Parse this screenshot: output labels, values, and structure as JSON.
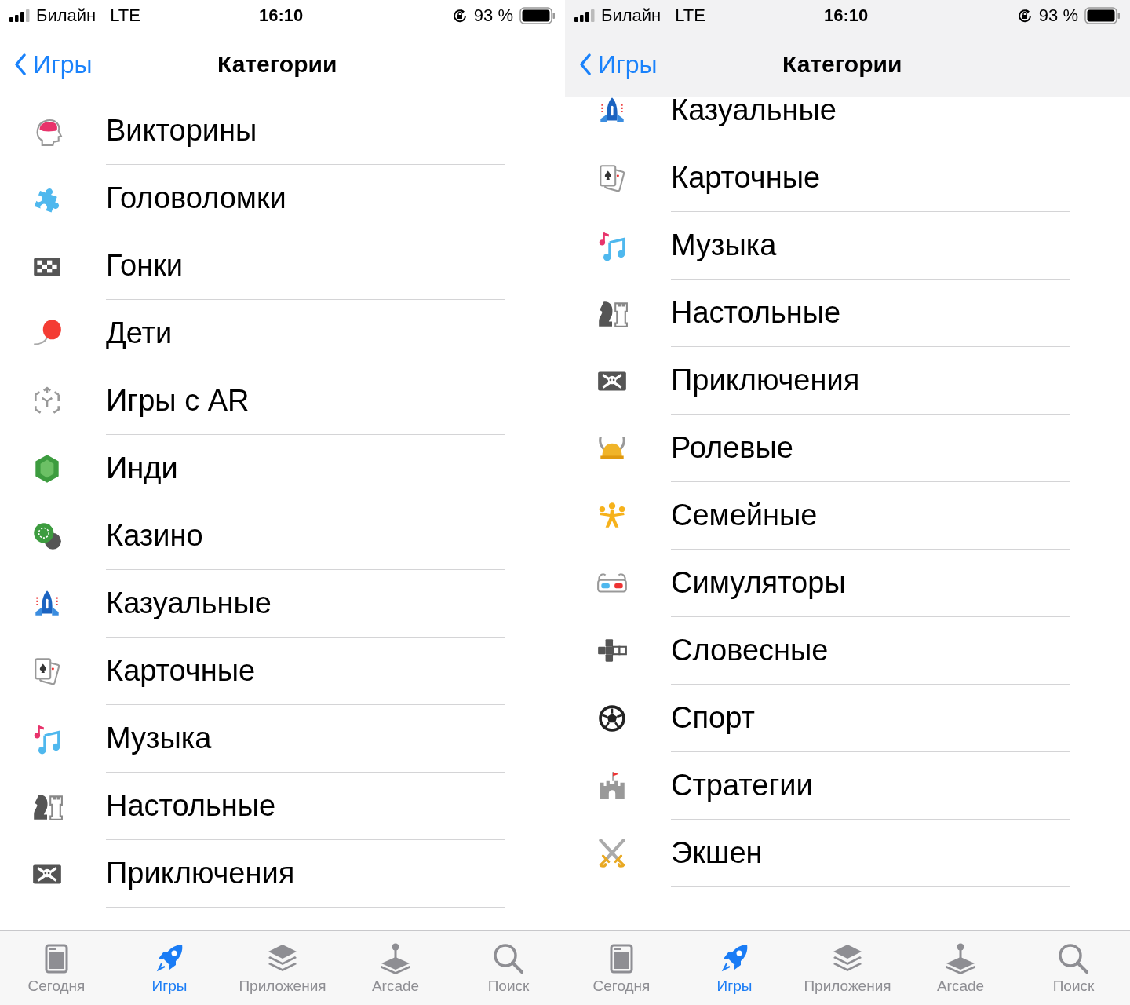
{
  "screens": [
    {
      "status_bar": {
        "carrier": "Билайн",
        "network": "LTE",
        "time": "16:10",
        "battery": "93 %"
      },
      "nav_bar": {
        "back": "Игры",
        "title": "Категории",
        "scrolled": false
      },
      "categories": [
        {
          "label": "Викторины"
        },
        {
          "label": "Головоломки"
        },
        {
          "label": "Гонки"
        },
        {
          "label": "Дети"
        },
        {
          "label": "Игры с AR"
        },
        {
          "label": "Инди"
        },
        {
          "label": "Казино"
        },
        {
          "label": "Казуальные"
        },
        {
          "label": "Карточные"
        },
        {
          "label": "Музыка"
        },
        {
          "label": "Настольные"
        },
        {
          "label": "Приключения"
        }
      ],
      "tab_bar": [
        {
          "label": "Сегодня",
          "selected": false
        },
        {
          "label": "Игры",
          "selected": true
        },
        {
          "label": "Приложения",
          "selected": false
        },
        {
          "label": "Arcade",
          "selected": false
        },
        {
          "label": "Поиск",
          "selected": false
        }
      ]
    },
    {
      "status_bar": {
        "carrier": "Билайн",
        "network": "LTE",
        "time": "16:10",
        "battery": "93 %"
      },
      "nav_bar": {
        "back": "Игры",
        "title": "Категории",
        "scrolled": true
      },
      "categories": [
        {
          "label": "Казуальные"
        },
        {
          "label": "Карточные"
        },
        {
          "label": "Музыка"
        },
        {
          "label": "Настольные"
        },
        {
          "label": "Приключения"
        },
        {
          "label": "Ролевые"
        },
        {
          "label": "Семейные"
        },
        {
          "label": "Симуляторы"
        },
        {
          "label": "Словесные"
        },
        {
          "label": "Спорт"
        },
        {
          "label": "Стратегии"
        },
        {
          "label": "Экшен"
        }
      ],
      "tab_bar": [
        {
          "label": "Сегодня",
          "selected": false
        },
        {
          "label": "Игры",
          "selected": true
        },
        {
          "label": "Приложения",
          "selected": false
        },
        {
          "label": "Arcade",
          "selected": false
        },
        {
          "label": "Поиск",
          "selected": false
        }
      ]
    }
  ]
}
